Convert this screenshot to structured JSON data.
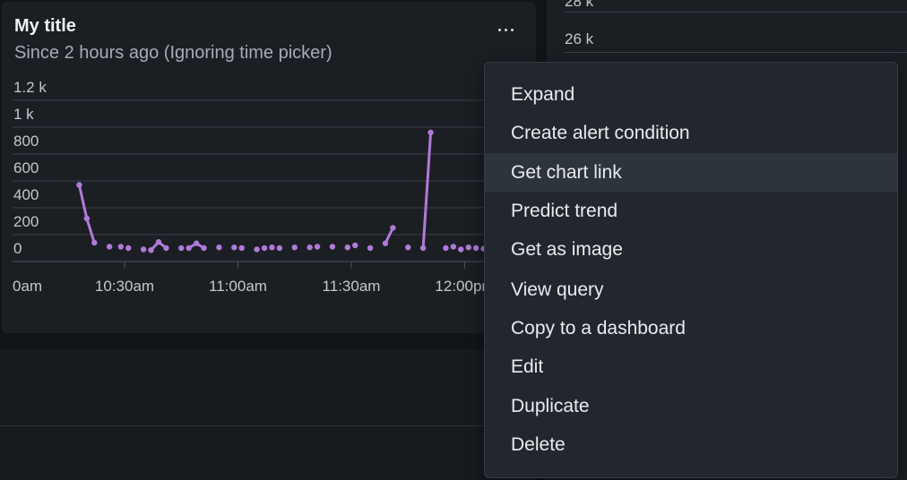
{
  "card": {
    "title": "My title",
    "subtitle": "Since 2 hours ago (Ignoring time picker)",
    "more_icon": "ellipsis-horizontal-icon"
  },
  "right_panel": {
    "tick_top": "28 k",
    "tick_26k": "26 k"
  },
  "chart_data": {
    "type": "line",
    "ylim": [
      0,
      1200
    ],
    "y_ticks": [
      "1.2 k",
      "1 k",
      "800",
      "600",
      "400",
      "200",
      "0"
    ],
    "x_ticks": [
      "0am",
      "10:30am",
      "11:00am",
      "11:30am",
      "12:00pm"
    ],
    "series_color": "#b07ad8",
    "series": [
      {
        "values": [
          {
            "t": "10:18",
            "v": 570
          },
          {
            "t": "10:20",
            "v": 320
          },
          {
            "t": "10:22",
            "v": 140
          },
          {
            "t": "10:26",
            "v": 110
          },
          {
            "t": "10:29",
            "v": 110
          },
          {
            "t": "10:31",
            "v": 100
          },
          {
            "t": "10:35",
            "v": 90
          },
          {
            "t": "10:37",
            "v": 85
          },
          {
            "t": "10:39",
            "v": 145
          },
          {
            "t": "10:41",
            "v": 100
          },
          {
            "t": "10:45",
            "v": 100
          },
          {
            "t": "10:47",
            "v": 100
          },
          {
            "t": "10:49",
            "v": 135
          },
          {
            "t": "10:51",
            "v": 100
          },
          {
            "t": "10:55",
            "v": 105
          },
          {
            "t": "10:59",
            "v": 105
          },
          {
            "t": "11:01",
            "v": 100
          },
          {
            "t": "11:05",
            "v": 90
          },
          {
            "t": "11:07",
            "v": 100
          },
          {
            "t": "11:09",
            "v": 105
          },
          {
            "t": "11:11",
            "v": 100
          },
          {
            "t": "11:15",
            "v": 105
          },
          {
            "t": "11:19",
            "v": 105
          },
          {
            "t": "11:21",
            "v": 110
          },
          {
            "t": "11:25",
            "v": 110
          },
          {
            "t": "11:29",
            "v": 105
          },
          {
            "t": "11:31",
            "v": 120
          },
          {
            "t": "11:35",
            "v": 100
          },
          {
            "t": "11:39",
            "v": 135
          },
          {
            "t": "11:41",
            "v": 250
          },
          {
            "t": "11:45",
            "v": 105
          },
          {
            "t": "11:49",
            "v": 100
          },
          {
            "t": "11:51",
            "v": 960
          },
          {
            "t": "11:55",
            "v": 100
          },
          {
            "t": "11:57",
            "v": 110
          },
          {
            "t": "11:59",
            "v": 90
          },
          {
            "t": "12:01",
            "v": 105
          },
          {
            "t": "12:03",
            "v": 100
          },
          {
            "t": "12:05",
            "v": 95
          }
        ]
      }
    ]
  },
  "menu": {
    "items": [
      {
        "label": "Expand",
        "highlighted": false
      },
      {
        "label": "Create alert condition",
        "highlighted": false
      },
      {
        "label": "Get chart link",
        "highlighted": true
      },
      {
        "label": "Predict trend",
        "highlighted": false
      },
      {
        "label": "Get as image",
        "highlighted": false
      },
      {
        "label": "View query",
        "highlighted": false
      },
      {
        "label": "Copy to a dashboard",
        "highlighted": false
      },
      {
        "label": "Edit",
        "highlighted": false
      },
      {
        "label": "Duplicate",
        "highlighted": false
      },
      {
        "label": "Delete",
        "highlighted": false
      }
    ]
  }
}
